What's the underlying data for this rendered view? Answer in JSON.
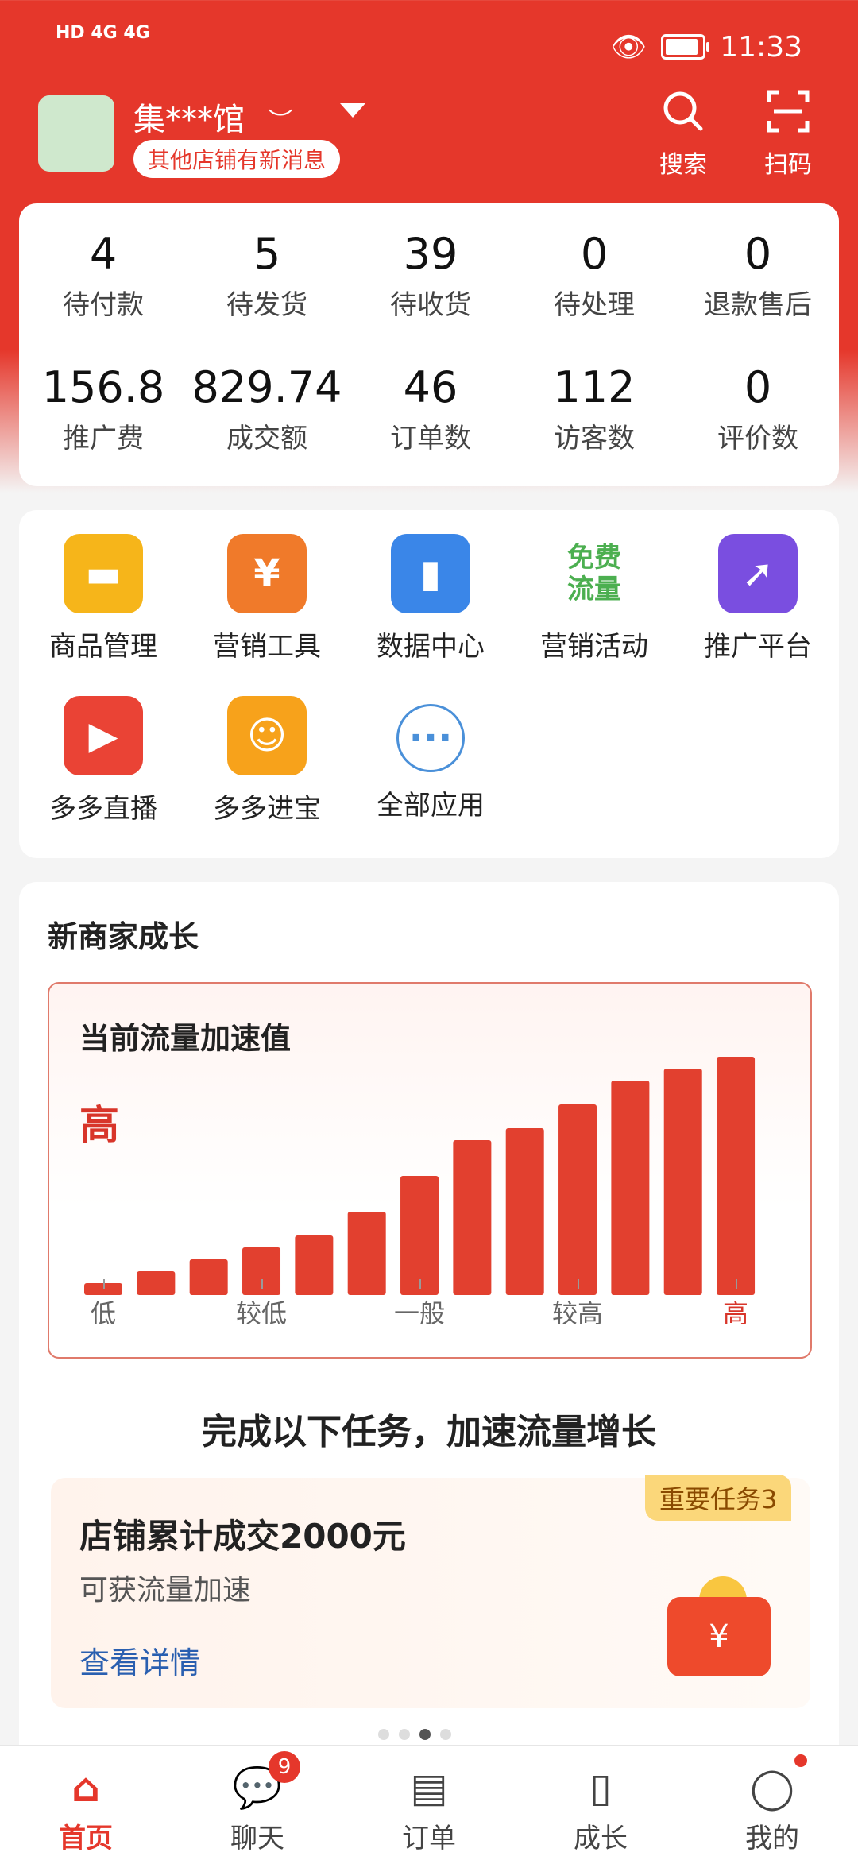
{
  "status_bar": {
    "left_text": "HD 4G 4G",
    "time": "11:33",
    "battery_level": 0.9
  },
  "header": {
    "shop_name": "集***馆",
    "notice": "其他店铺有新消息",
    "search_label": "搜索",
    "scan_label": "扫码"
  },
  "stats": [
    {
      "value": "4",
      "label": "待付款"
    },
    {
      "value": "5",
      "label": "待发货"
    },
    {
      "value": "39",
      "label": "待收货"
    },
    {
      "value": "0",
      "label": "待处理"
    },
    {
      "value": "0",
      "label": "退款售后"
    },
    {
      "value": "156.8",
      "label": "推广费"
    },
    {
      "value": "829.74",
      "label": "成交额"
    },
    {
      "value": "46",
      "label": "订单数"
    },
    {
      "value": "112",
      "label": "访客数"
    },
    {
      "value": "0",
      "label": "评价数"
    }
  ],
  "apps": [
    {
      "label": "商品管理",
      "icon": "bag-icon",
      "color": "#f6b51a"
    },
    {
      "label": "营销工具",
      "icon": "ticket-icon",
      "color": "#f07a2a"
    },
    {
      "label": "数据中心",
      "icon": "chart-icon",
      "color": "#3a86e8"
    },
    {
      "label": "营销活动",
      "icon": "free-traffic-icon",
      "color": "#4caf50",
      "icon_text": "免费\n流量"
    },
    {
      "label": "推广平台",
      "icon": "rocket-icon",
      "color": "#7a4ee0"
    },
    {
      "label": "多多直播",
      "icon": "video-icon",
      "color": "#ea4335"
    },
    {
      "label": "多多进宝",
      "icon": "mascot-icon",
      "color": "#f7a21b"
    },
    {
      "label": "全部应用",
      "icon": "more-icon",
      "color": "#4a90d9"
    }
  ],
  "growth": {
    "title": "新商家成长",
    "chart_title": "当前流量加速值",
    "level": "高",
    "task_heading": "完成以下任务，加速流量增长",
    "task": {
      "badge": "重要任务3",
      "title": "店铺累计成交2000元",
      "subtitle": "可获流量加速",
      "link": "查看详情"
    }
  },
  "chart_data": {
    "type": "bar",
    "values": [
      1,
      2,
      3,
      4,
      5,
      7,
      10,
      13,
      14,
      16,
      18,
      19,
      20
    ],
    "axis_labels": [
      "低",
      "较低",
      "一般",
      "较高",
      "高"
    ],
    "active_label": "高",
    "bar_color": "#e2402f"
  },
  "tabs": [
    {
      "label": "首页",
      "icon": "home-icon",
      "active": true
    },
    {
      "label": "聊天",
      "icon": "chat-icon",
      "badge": "9"
    },
    {
      "label": "订单",
      "icon": "order-icon"
    },
    {
      "label": "成长",
      "icon": "book-icon"
    },
    {
      "label": "我的",
      "icon": "user-icon"
    }
  ]
}
